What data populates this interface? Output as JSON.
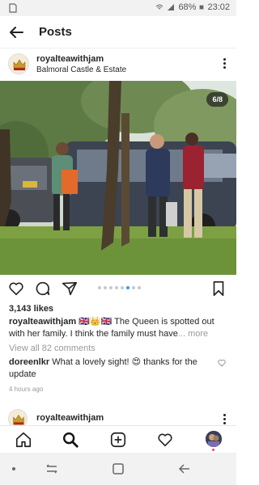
{
  "status_bar": {
    "battery": "68%",
    "time": "23:02"
  },
  "top_bar": {
    "title": "Posts"
  },
  "post": {
    "username": "royalteawithjam",
    "location": "Balmoral Castle & Estate",
    "image_counter": "6/8",
    "carousel": {
      "count": 8,
      "active_index": 5
    },
    "likes": "3,143 likes",
    "caption_user": "royalteawithjam",
    "caption_flags": "🇬🇧👑🇬🇧",
    "caption_text": " The Queen is spotted out with her family. I think the family must have",
    "caption_more": "... more",
    "view_comments": "View all 82 comments",
    "comment_user": "doreenlkr",
    "comment_text": " What a lovely sight! 😍 thanks for the update",
    "time_ago": "4 hours ago"
  },
  "next_post": {
    "username": "royalteawithjam"
  },
  "icons": {
    "top_bar": [
      "back-arrow-icon"
    ],
    "actions": [
      "heart-icon",
      "comment-icon",
      "share-icon",
      "bookmark-icon"
    ],
    "bottom_nav": [
      "home-icon",
      "search-icon",
      "new-post-icon",
      "activity-heart-icon",
      "profile-avatar"
    ],
    "system_nav": [
      "dot-icon",
      "recents-icon",
      "home-square-icon",
      "back-icon"
    ]
  },
  "colors": {
    "accent_blue": "#3897f0",
    "notification_red": "#ed4956",
    "text": "#262626",
    "muted": "#999999"
  }
}
